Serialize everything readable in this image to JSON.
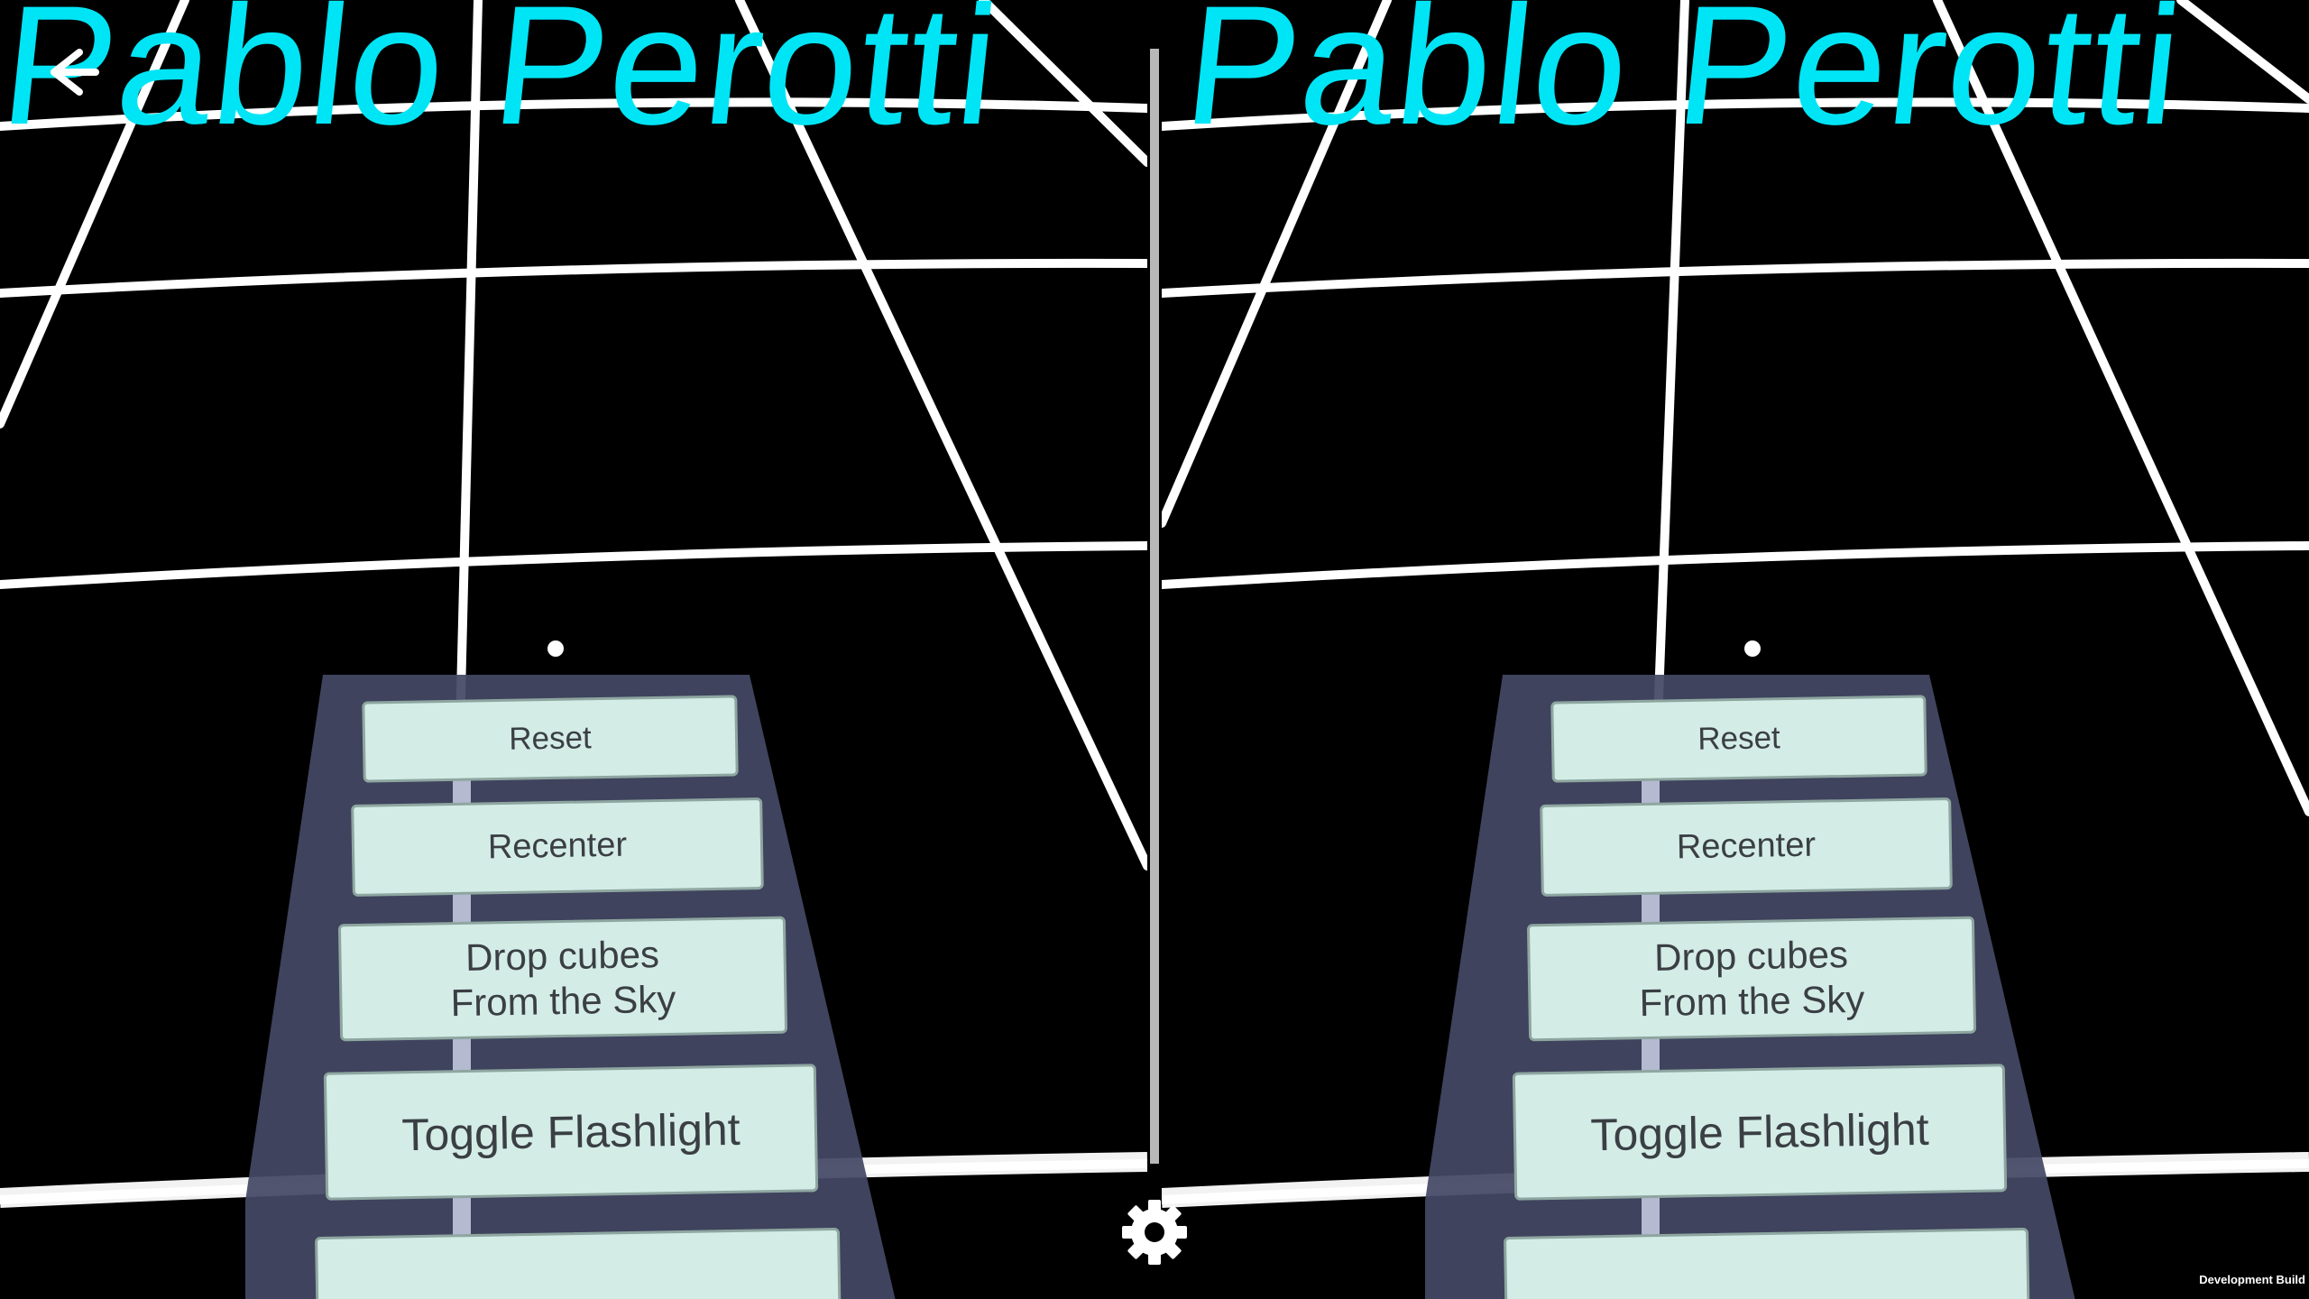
{
  "scene": {
    "world_title": "Pablo Perotti",
    "title_color": "#00e5f5",
    "grid_color": "#ffffff",
    "panel_color": "#444864",
    "button_color": "#d4ece6"
  },
  "menu": {
    "buttons": [
      {
        "label": "Reset"
      },
      {
        "label": "Recenter"
      },
      {
        "label_line1": "Drop cubes",
        "label_line2": "From the Sky"
      },
      {
        "label": "Toggle Flashlight"
      }
    ]
  },
  "overlay": {
    "back_icon": "back-arrow-icon",
    "settings_icon": "gear-icon",
    "build_label": "Development Build"
  }
}
